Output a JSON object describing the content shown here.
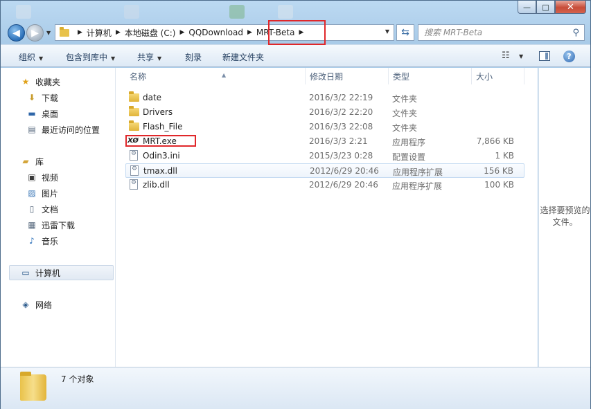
{
  "window": {
    "minimize_glyph": "—",
    "maximize_glyph": "□",
    "close_glyph": "✕"
  },
  "address_bar": {
    "crumbs": [
      "计算机",
      "本地磁盘 (C:)",
      "QQDownload",
      "MRT-Beta"
    ],
    "refresh_icon": "refresh-icon"
  },
  "search": {
    "placeholder": "搜索 MRT-Beta"
  },
  "toolbar": {
    "organize": "组织",
    "include_in_library": "包含到库中",
    "share": "共享",
    "burn": "刻录",
    "new_folder": "新建文件夹"
  },
  "nav_pane": {
    "favorites": "收藏夹",
    "downloads": "下载",
    "desktop": "桌面",
    "recent": "最近访问的位置",
    "libraries": "库",
    "videos": "视频",
    "pictures": "图片",
    "documents": "文档",
    "xunlei": "迅雷下载",
    "music": "音乐",
    "computer": "计算机",
    "network": "网络"
  },
  "columns": {
    "name": "名称",
    "modified": "修改日期",
    "type": "类型",
    "size": "大小"
  },
  "files": [
    {
      "name": "date",
      "modified": "2016/3/2 22:19",
      "type": "文件夹",
      "size": "",
      "icon": "folder-icon"
    },
    {
      "name": "Drivers",
      "modified": "2016/3/2 22:20",
      "type": "文件夹",
      "size": "",
      "icon": "folder-icon"
    },
    {
      "name": "Flash_File",
      "modified": "2016/3/3 22:08",
      "type": "文件夹",
      "size": "",
      "icon": "folder-icon"
    },
    {
      "name": "MRT.exe",
      "modified": "2016/3/3 2:21",
      "type": "应用程序",
      "size": "7,866 KB",
      "icon": "exe-icon"
    },
    {
      "name": "Odin3.ini",
      "modified": "2015/3/23 0:28",
      "type": "配置设置",
      "size": "1 KB",
      "icon": "config-file-icon"
    },
    {
      "name": "tmax.dll",
      "modified": "2012/6/29 20:46",
      "type": "应用程序扩展",
      "size": "156 KB",
      "icon": "dll-icon"
    },
    {
      "name": "zlib.dll",
      "modified": "2012/6/29 20:46",
      "type": "应用程序扩展",
      "size": "100 KB",
      "icon": "dll-icon"
    }
  ],
  "preview_pane": {
    "message": "选择要预览的文件。"
  },
  "details_pane": {
    "count": "7 个对象"
  },
  "colors": {
    "highlight_box": "#e0272a",
    "accent": "#2a6fb8"
  }
}
